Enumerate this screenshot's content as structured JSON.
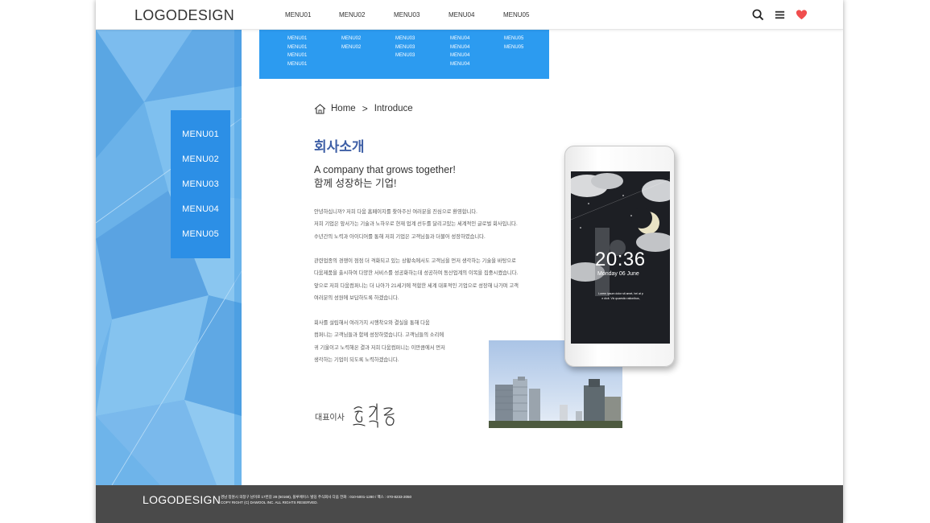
{
  "header": {
    "logo": "LOGODESIGN",
    "menu": [
      "MENU01",
      "MENU02",
      "MENU03",
      "MENU04",
      "MENU05"
    ],
    "icons": [
      "search-icon",
      "hamburger-icon",
      "heart-icon"
    ]
  },
  "dropdown": {
    "columns": [
      [
        "MENU01",
        "MENU01",
        "MENU01",
        "MENU01"
      ],
      [
        "MENU02",
        "MENU02"
      ],
      [
        "MENU03",
        "MENU03",
        "MENU03"
      ],
      [
        "MENU04",
        "MENU04",
        "MENU04",
        "MENU04"
      ],
      [
        "MENU05",
        "MENU05"
      ]
    ]
  },
  "sidebar": {
    "items": [
      "MENU01",
      "MENU02",
      "MENU03",
      "MENU04",
      "MENU05"
    ]
  },
  "breadcrumb": {
    "home": "Home",
    "separator": ">",
    "current": "Introduce"
  },
  "content": {
    "title": "회사소개",
    "subtitle_en": "A company that grows together!",
    "subtitle_ko": "함께 성장하는 기업!",
    "paragraphs": [
      [
        "안녕하십니까? 저희 다움 홈페이지를 찾아주신 여러분을 진심으로 환영합니다.",
        "저희 기업은 앞서가는 기술과 노하우로 현재 업계 선두를 달리고있는 세계적인 글로벌 회사입니다.",
        "수년간의 노력과 아이디어를 통해 저희 기업은 고객님들과 더불어 성장하였습니다."
      ],
      [
        "관련업종의 경쟁이 점점 더 격화되고 있는 상황속에서도 고객님을 먼저 생각하는 기술을 바탕으로",
        "다움제품을 출시하여 다양한 서비스를 성공화하는데 성공하여 동산업계의 이목을 집중시켰습니다.",
        "앞으로 저희 다움컴퍼니는 더 나아가 21세기에 적합한 세계 대표적인 기업으로 성장해 나가며 고객",
        "여러분의 성원에 보답하도록 하겠습니다."
      ],
      [
        "회사를 설립해서 여러가지 시행착오와 결실을 통해 다움",
        "컴퍼니는 고객님들과 함께 성장하였습니다. 고객님들의 소리에",
        "귀 기울이고 노력해온 결과 저희 다움컴퍼니는 이만큼에서 먼저",
        "생각하는 기업이 되도록 노력하겠습니다."
      ]
    ],
    "ceo_label": "대표이사",
    "ceo_signature": "홍길동"
  },
  "phone": {
    "time": "20:36",
    "date": "Monday 06 June",
    "lorem1": "Lorem ipsum dolor sit amet, hei at p",
    "lorem2": "e dicit. Vix quaestio rationibus,"
  },
  "footer": {
    "logo": "LOGODESIGN",
    "address": "경남 창원시 의창구 남이로 17번길 28 (50168), 블루에이스 빌딩 주식회사 다움 전화 : 010-5001-1280 / 팩스 : 070-8233-2050",
    "copyright": "COPY RIGHT (C) DAWOOL INC. ALL RIGHTS RESERVED."
  },
  "colors": {
    "accent_blue": "#2c8fe6",
    "sidebar_bg": "#6db3ea",
    "title_blue": "#3d5ea5",
    "footer_bg": "#4a4a4a",
    "heart": "#f04e4e"
  }
}
